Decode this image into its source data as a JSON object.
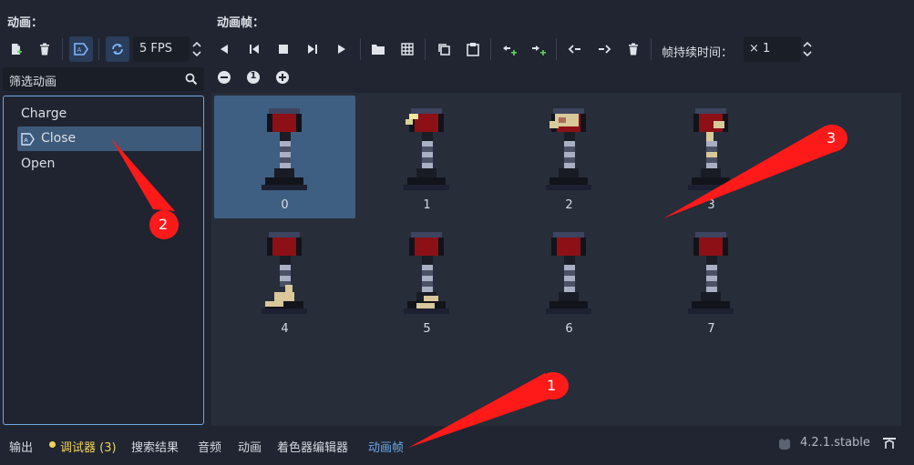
{
  "left_header": "动画：",
  "right_header": "动画帧：",
  "fps_value": "5 FPS",
  "filter_placeholder": "筛选动画",
  "zoom_reset_label": "1",
  "frame_duration_label": "帧持续时间：",
  "frame_duration_value": "× 1",
  "animations": [
    "Charge",
    "Close",
    "Open"
  ],
  "frames": [
    "0",
    "1",
    "2",
    "3",
    "4",
    "5",
    "6",
    "7"
  ],
  "bottom_tabs": {
    "output": "输出",
    "debugger": "调试器 (3)",
    "search": "搜索结果",
    "audio": "音频",
    "animation": "动画",
    "shader": "着色器编辑器",
    "spriteframes": "动画帧"
  },
  "version": "4.2.1.stable",
  "annotations": [
    "1",
    "2",
    "3"
  ],
  "colors": {
    "accent": "#6ea8e6",
    "selected": "#3e5f81",
    "annotation_red": "#ff1a1a",
    "debugger_yellow": "#f2d35c"
  }
}
